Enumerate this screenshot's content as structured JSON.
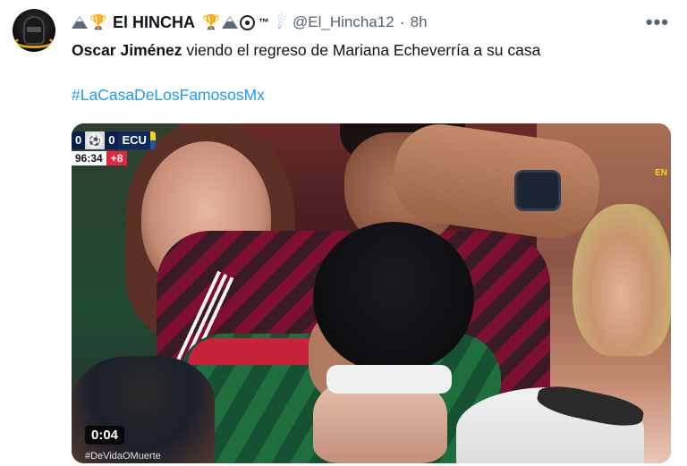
{
  "account": {
    "display_name": "El HINCHA",
    "badge": "™",
    "handle": "@El_Hincha12",
    "time": "8h",
    "avatar_icon": "darth-vader-helmet-icon"
  },
  "post": {
    "text_bold": "Oscar Jiménez",
    "text_rest": " viendo el regreso de Mariana Echeverría a su casa",
    "hashtag": "#LaCasaDeLosFamososMx"
  },
  "media": {
    "duration": "0:04",
    "scoreboard": {
      "home_score": "0",
      "away_score": "0",
      "away_team": "ECU",
      "clock": "96:34",
      "added_time": "+8"
    },
    "side_tag": "EN",
    "caption_fragment": "#DeVidaOMuerte"
  },
  "colors": {
    "link": "#1d9bf0",
    "secondary_text": "#536471",
    "added_time": "#e5273e",
    "scoreboard_bg": "#0e2a5e"
  },
  "menu": {
    "more_label": "•••"
  }
}
